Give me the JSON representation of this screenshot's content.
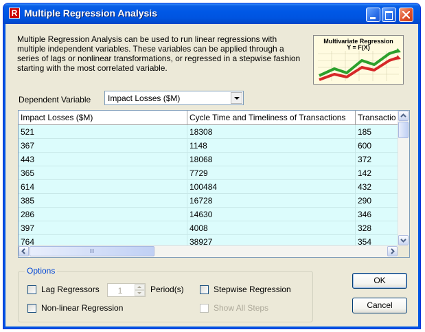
{
  "window": {
    "title": "Multiple Regression Analysis",
    "icon_letter": "R"
  },
  "description": "Multiple Regression Analysis can be used to run linear regressions with multiple independent variables. These variables can be applied through a series of lags or nonlinear transformations, or regressed in a stepwise fashion starting with the most correlated variable.",
  "logo": {
    "title_line1": "Multivariate Regression",
    "title_line2": "Y = F(X)"
  },
  "dependent_variable": {
    "label": "Dependent Variable",
    "selected": "Impact Losses ($M)"
  },
  "grid": {
    "columns": [
      "Impact Losses ($M)",
      "Cycle Time and Timeliness of Transactions",
      "Transactio"
    ],
    "rows": [
      [
        "521",
        "18308",
        "185"
      ],
      [
        "367",
        "1148",
        "600"
      ],
      [
        "443",
        "18068",
        "372"
      ],
      [
        "365",
        "7729",
        "142"
      ],
      [
        "614",
        "100484",
        "432"
      ],
      [
        "385",
        "16728",
        "290"
      ],
      [
        "286",
        "14630",
        "346"
      ],
      [
        "397",
        "4008",
        "328"
      ],
      [
        "764",
        "38927",
        "354"
      ]
    ],
    "hscroll_grip": "III"
  },
  "options": {
    "legend": "Options",
    "lag_regressors": {
      "label": "Lag Regressors",
      "checked": false
    },
    "periods_value": "1",
    "periods_label": "Period(s)",
    "nonlinear": {
      "label": "Non-linear Regression",
      "checked": false
    },
    "stepwise": {
      "label": "Stepwise Regression",
      "checked": false
    },
    "show_all_steps": {
      "label": "Show All Steps",
      "checked": false,
      "enabled": false
    }
  },
  "buttons": {
    "ok": "OK",
    "cancel": "Cancel"
  },
  "colors": {
    "titlebar": "#0054e3",
    "dialog_bg": "#ece9d8",
    "grid_row_bg": "#dcfcfc",
    "options_legend": "#0046d5"
  }
}
